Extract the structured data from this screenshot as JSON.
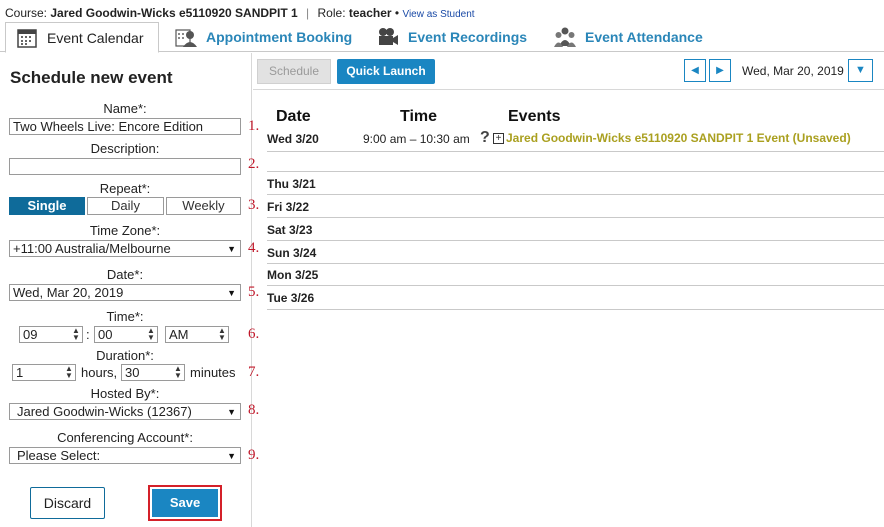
{
  "topbar": {
    "course_label": "Course:",
    "course_name": "Jared Goodwin-Wicks e5110920 SANDPIT 1",
    "role_label": "Role:",
    "role_value": "teacher",
    "bullet": "•",
    "view_as_student": "View as Student"
  },
  "tabs": [
    {
      "label": "Event Calendar",
      "icon": "calendar-icon"
    },
    {
      "label": "Appointment Booking",
      "icon": "user-booking-icon"
    },
    {
      "label": "Event Recordings",
      "icon": "video-camera-icon"
    },
    {
      "label": "Event Attendance",
      "icon": "group-attendance-icon"
    }
  ],
  "form": {
    "heading": "Schedule new event",
    "name_label": "Name*:",
    "name_value": "Two Wheels Live: Encore Edition",
    "description_label": "Description:",
    "description_value": "",
    "repeat_label": "Repeat*:",
    "repeat_options": [
      "Single",
      "Daily",
      "Weekly"
    ],
    "repeat_selected": "Single",
    "timezone_label": "Time Zone*:",
    "timezone_value": "+11:00 Australia/Melbourne",
    "date_label": "Date*:",
    "date_value": "Wed, Mar 20, 2019",
    "time_label": "Time*:",
    "time_hour": "09",
    "time_colon": ":",
    "time_minute": "00",
    "time_ampm": "AM",
    "duration_label": "Duration*:",
    "duration_hours": "1",
    "duration_hours_unit": "hours,",
    "duration_minutes": "30",
    "duration_minutes_unit": "minutes",
    "hosted_label": "Hosted By*:",
    "hosted_value": "Jared Goodwin-Wicks (12367)",
    "conf_label": "Conferencing Account*:",
    "conf_value": "Please Select:",
    "discard_label": "Discard",
    "save_label": "Save"
  },
  "annotations": [
    "1.",
    "2.",
    "3.",
    "4.",
    "5.",
    "6.",
    "7.",
    "8.",
    "9."
  ],
  "toolbar": {
    "schedule_label": "Schedule",
    "quick_launch_label": "Quick Launch",
    "prev_icon": "◀",
    "next_icon": "▶",
    "current_date": "Wed, Mar 20, 2019",
    "dropdown_icon": "▼"
  },
  "calendar": {
    "col_date": "Date",
    "col_time": "Time",
    "col_events": "Events",
    "days": [
      "Wed 3/20",
      "Thu 3/21",
      "Fri 3/22",
      "Sat 3/23",
      "Sun 3/24",
      "Mon 3/25",
      "Tue 3/26"
    ],
    "event": {
      "time": "9:00 am – 10:30 am",
      "help": "?",
      "expand": "+",
      "title": "Jared Goodwin-Wicks e5110920 SANDPIT 1 Event (Unsaved)",
      "color": "#aaa020"
    }
  },
  "colors": {
    "accent": "#1a86c2",
    "accent_dark": "#0f6b9a",
    "annotation_red": "#c0182a",
    "highlight_border": "#d42029"
  }
}
